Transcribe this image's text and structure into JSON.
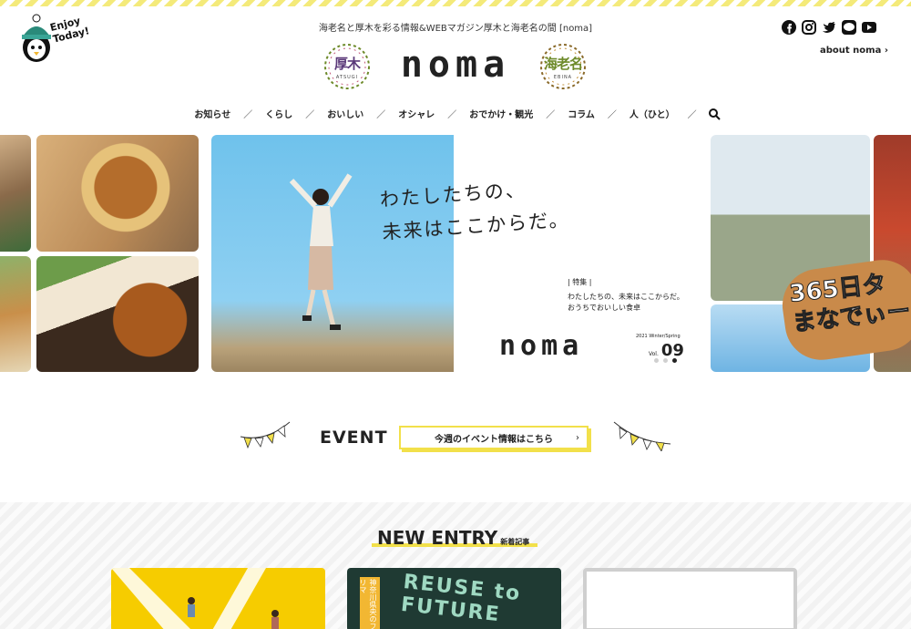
{
  "header": {
    "mascot_text": "Enjoy Today!",
    "tagline": "海老名と厚木を彩る情報&WEBマガジン厚木と海老名の間 [noma]",
    "brand": "noma",
    "left_city": {
      "kanji": "厚木",
      "en": "ATSUGI"
    },
    "right_city": {
      "kanji": "海老名",
      "en": "EBINA"
    },
    "about_label": "about noma",
    "social": [
      "facebook-icon",
      "instagram-icon",
      "twitter-icon",
      "line-icon",
      "youtube-icon"
    ]
  },
  "nav": {
    "items": [
      "お知らせ",
      "くらし",
      "おいしい",
      "オシャレ",
      "おでかけ・観光",
      "コラム",
      "人（ひと）"
    ],
    "separator": "／"
  },
  "hero": {
    "copy_line1": "わたしたちの、",
    "copy_line2": "未来はここからだ。",
    "feature_tag": "特集",
    "feature_line1": "わたしたちの、未来はここからだ。",
    "feature_line2": "おうちでおいしい食卓",
    "brand": "noma",
    "issue": "2021 Winter/Spring",
    "vol_label": "Vol.",
    "vol_number": "09",
    "side_badge": "365日タ まなでぃー"
  },
  "event": {
    "title": "EVENT",
    "button_label": "今週のイベント情報はこちら",
    "button_arrow": "›"
  },
  "new_entry": {
    "title": "NEW ENTRY",
    "subtitle": "新着記事",
    "card2_text": "REUSE to FUTURE",
    "card2_side": "神奈川県央のフリマ"
  },
  "colors": {
    "accent_yellow": "#f2e04a",
    "text": "#222222"
  }
}
